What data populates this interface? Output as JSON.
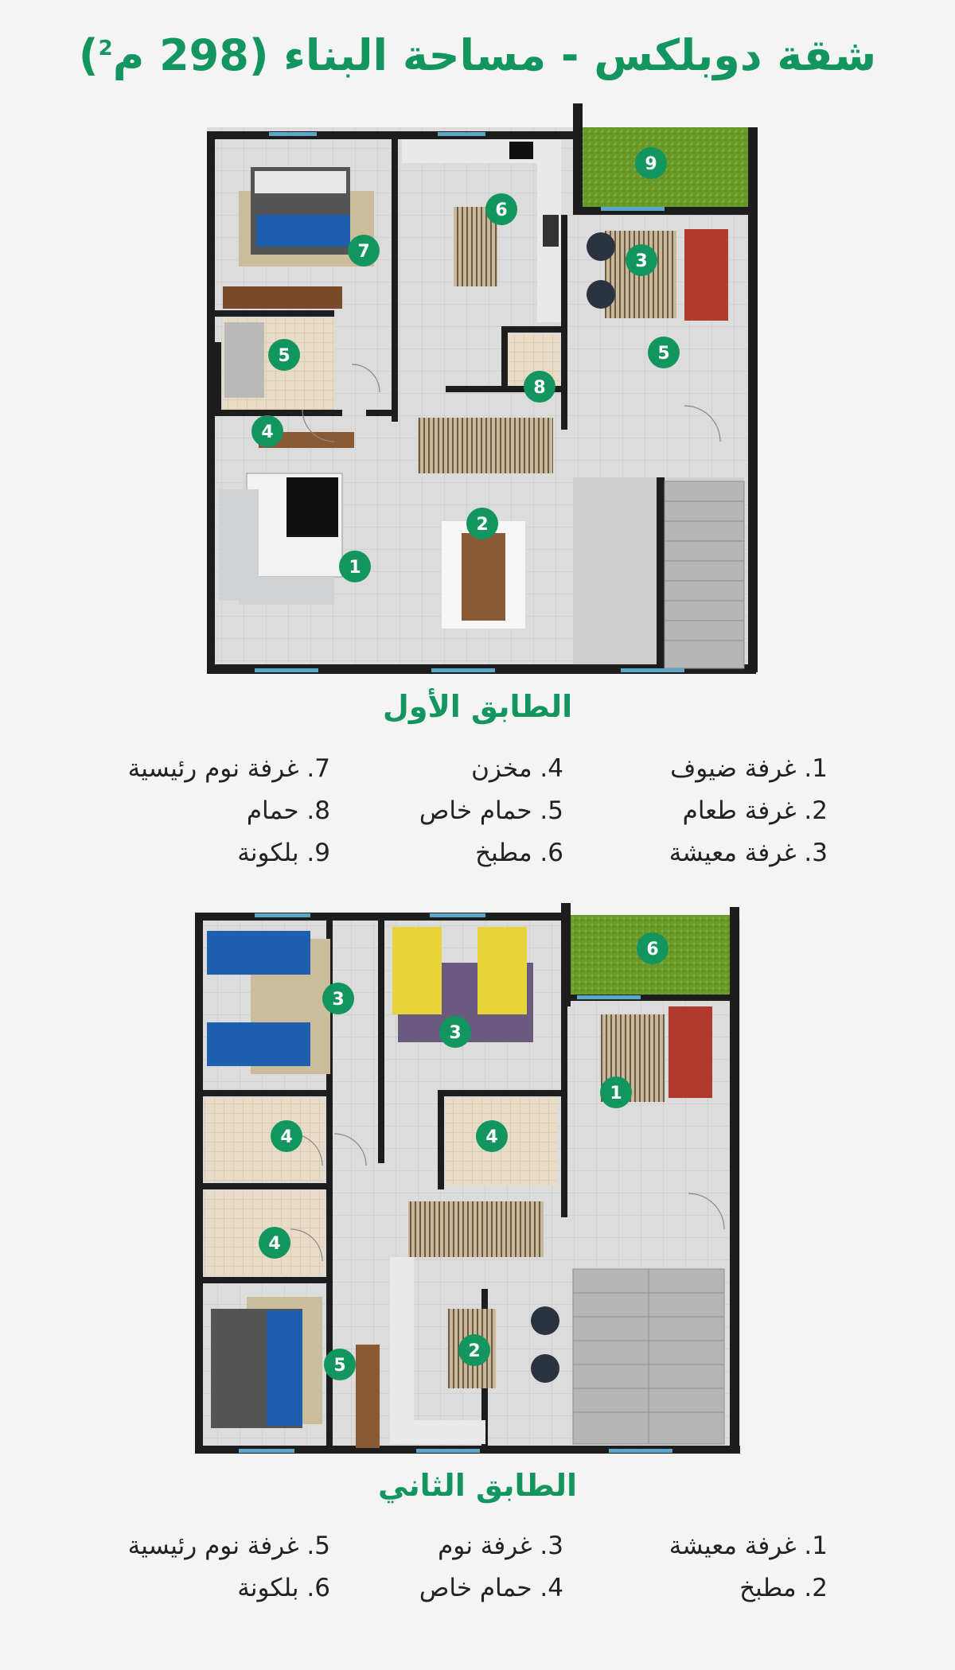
{
  "title": {
    "text": "شقة دوبلكس - مساحة البناء (298 م",
    "sup": "2",
    "close": ")"
  },
  "colors": {
    "accent": "#12955f",
    "wall": "#1d1d1d",
    "floor_tile": "#dcdcdc",
    "wood": "#a8784c",
    "balcony": "#6a9a2a",
    "sofa_red": "#b03a2e",
    "bed_blue": "#1e5fae"
  },
  "floor1": {
    "title": "الطابق الأول",
    "legend": [
      {
        "num": "1",
        "text": "1. غرفة ضيوف"
      },
      {
        "num": "2",
        "text": "2. غرفة طعام"
      },
      {
        "num": "3",
        "text": "3. غرفة معيشة"
      },
      {
        "num": "4",
        "text": "4. مخزن"
      },
      {
        "num": "5",
        "text": "5. حمام خاص"
      },
      {
        "num": "6",
        "text": "6. مطبخ"
      },
      {
        "num": "7",
        "text": "7. غرفة نوم رئيسية"
      },
      {
        "num": "8",
        "text": "8. حمام"
      },
      {
        "num": "9",
        "text": "9. بلكونة"
      }
    ],
    "markers": [
      "9",
      "6",
      "3",
      "7",
      "5",
      "5",
      "8",
      "4",
      "2",
      "1"
    ]
  },
  "floor2": {
    "title": "الطابق الثاني",
    "legend": [
      {
        "num": "1",
        "text": "1. غرفة معيشة"
      },
      {
        "num": "2",
        "text": "2. مطبخ"
      },
      {
        "num": "3",
        "text": "3. غرفة نوم"
      },
      {
        "num": "4",
        "text": "4. حمام خاص"
      },
      {
        "num": "5",
        "text": "5. غرفة نوم رئيسية"
      },
      {
        "num": "6",
        "text": "6. بلكونة"
      }
    ],
    "markers": [
      "6",
      "3",
      "3",
      "1",
      "4",
      "4",
      "4",
      "2",
      "5"
    ]
  }
}
